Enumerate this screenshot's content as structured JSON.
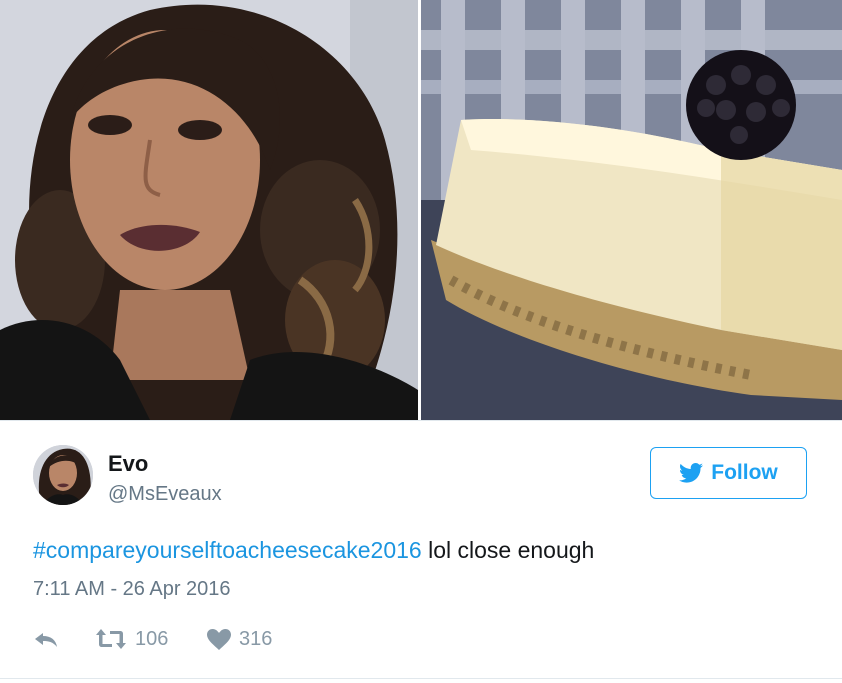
{
  "tweet": {
    "author": {
      "display_name": "Evo",
      "handle": "@MsEveaux"
    },
    "follow_label": "Follow",
    "hashtag": "#compareyourselftoacheesecake2016",
    "text_rest": " lol close enough",
    "timestamp": "7:11 AM - 26 Apr 2016",
    "retweet_count": "106",
    "like_count": "316"
  },
  "colors": {
    "brand_blue": "#1da1f2",
    "link_blue": "#1b95e0",
    "secondary_text": "#657786",
    "icon_gray": "#8899a6"
  },
  "icons": [
    "twitter-bird-icon",
    "reply-icon",
    "retweet-icon",
    "heart-icon"
  ],
  "media": [
    "selfie-photo",
    "cheesecake-photo"
  ]
}
